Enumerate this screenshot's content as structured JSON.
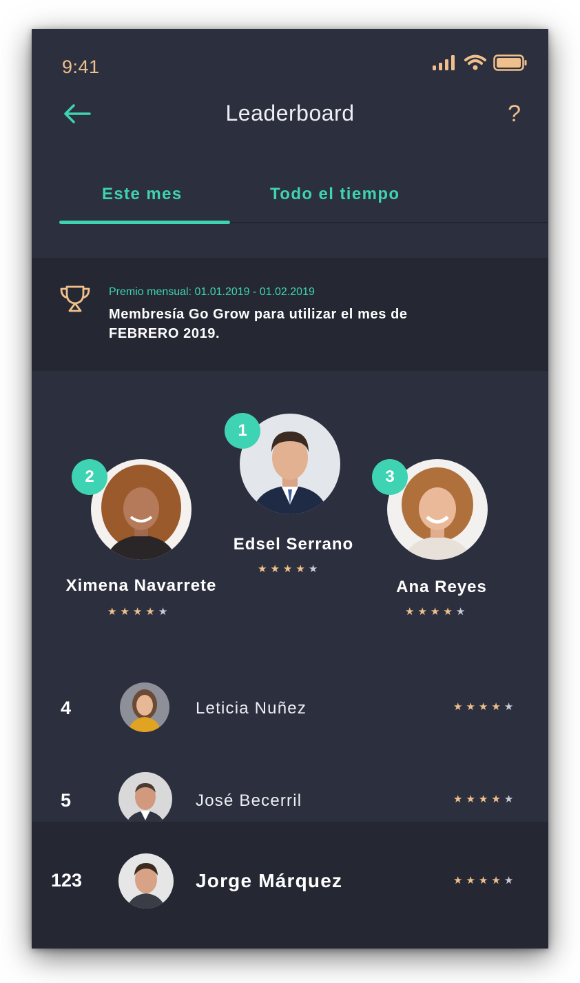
{
  "status_bar": {
    "time": "9:41"
  },
  "header": {
    "title": "Leaderboard",
    "help": "?"
  },
  "tabs": [
    {
      "label": "Este mes",
      "active": true
    },
    {
      "label": "Todo el tiempo",
      "active": false
    }
  ],
  "prize": {
    "label": "Premio mensual:  01.01.2019 - 01.02.2019",
    "text": "Membresía Go Grow para utilizar el mes de FEBRERO 2019."
  },
  "podium": [
    {
      "rank": "1",
      "name": "Edsel Serrano",
      "rating": 4
    },
    {
      "rank": "2",
      "name": "Ximena Navarrete",
      "rating": 4
    },
    {
      "rank": "3",
      "name": "Ana Reyes",
      "rating": 4
    }
  ],
  "list": [
    {
      "rank": "4",
      "name": "Leticia Nuñez",
      "rating": 4
    },
    {
      "rank": "5",
      "name": "José Becerril",
      "rating": 4
    }
  ],
  "current_user": {
    "rank": "123",
    "name": "Jorge Márquez",
    "rating": 4
  },
  "stars_total": 5,
  "colors": {
    "accent": "#3ed3b3",
    "gold": "#f0c08c",
    "background": "#2c2f3e",
    "panel": "#252833",
    "star_empty": "#c9ccd6"
  }
}
